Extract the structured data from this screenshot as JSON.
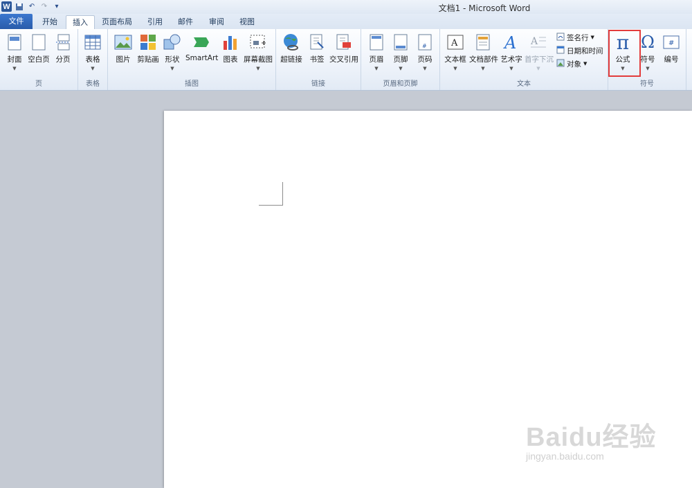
{
  "window": {
    "title": "文档1 - Microsoft Word"
  },
  "quick_access": {
    "app_icon": "W"
  },
  "tabs": [
    "文件",
    "开始",
    "插入",
    "页面布局",
    "引用",
    "邮件",
    "审阅",
    "视图"
  ],
  "groups": {
    "pages": {
      "label": "页",
      "buttons": [
        "封面",
        "空白页",
        "分页"
      ]
    },
    "tables": {
      "label": "表格",
      "buttons": [
        "表格"
      ]
    },
    "illustrations": {
      "label": "插图",
      "buttons": [
        "图片",
        "剪贴画",
        "形状",
        "SmartArt",
        "图表",
        "屏幕截图"
      ]
    },
    "links": {
      "label": "链接",
      "buttons": [
        "超链接",
        "书签",
        "交叉引用"
      ]
    },
    "header_footer": {
      "label": "页眉和页脚",
      "buttons": [
        "页眉",
        "页脚",
        "页码"
      ]
    },
    "text": {
      "label": "文本",
      "buttons": [
        "文本框",
        "文档部件",
        "艺术字",
        "首字下沉"
      ],
      "small": [
        "签名行",
        "日期和时间",
        "对象"
      ]
    },
    "symbols": {
      "label": "符号",
      "buttons": [
        "公式",
        "符号",
        "编号"
      ]
    }
  },
  "icons": {
    "equation": "π",
    "symbol": "Ω",
    "number": "#"
  },
  "colors": {
    "file_tab": "#2a5caa",
    "highlight": "#e23b3b"
  },
  "watermark": {
    "main": "Baidu经验",
    "sub": "jingyan.baidu.com"
  }
}
